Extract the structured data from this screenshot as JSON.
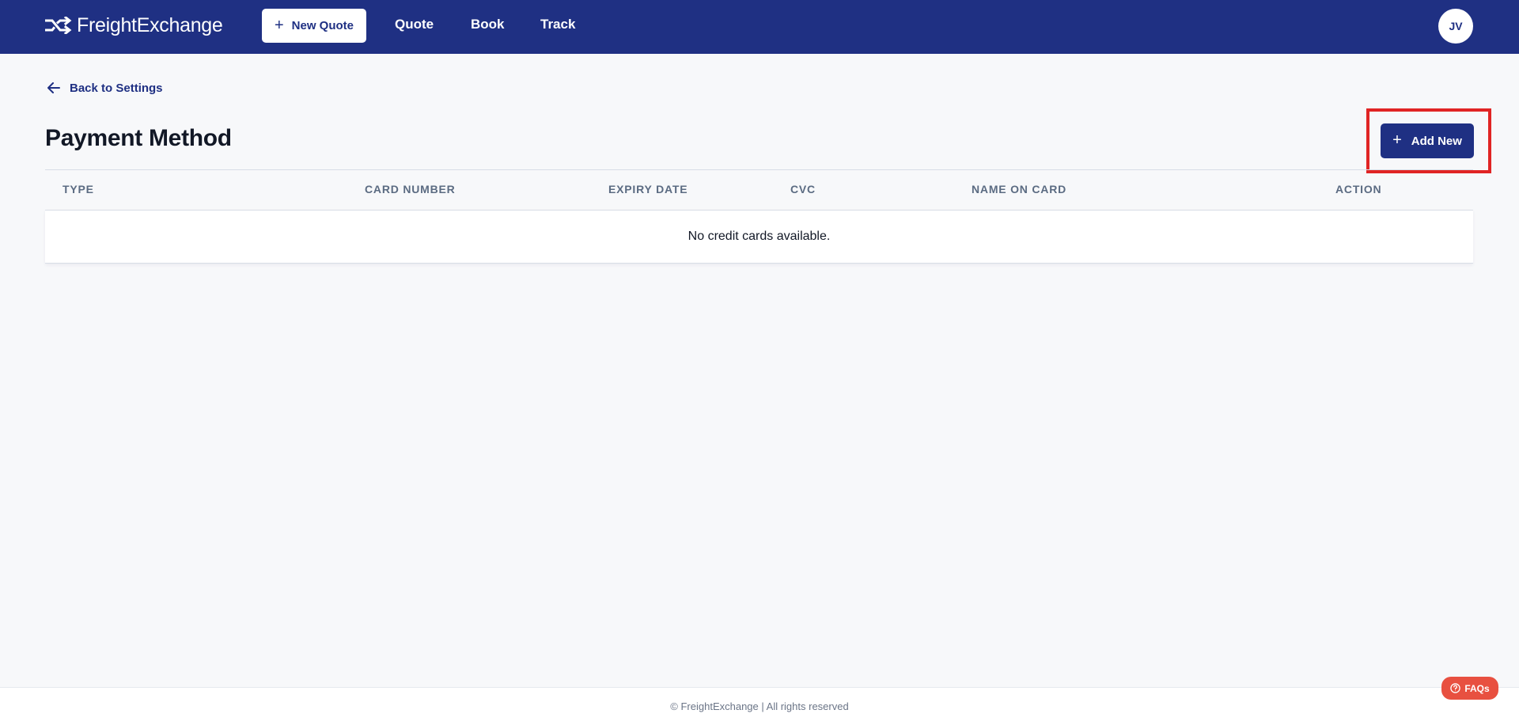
{
  "header": {
    "brand": "FreightExchange",
    "new_quote_label": "New Quote",
    "nav": [
      "Quote",
      "Book",
      "Track"
    ],
    "avatar_initials": "JV",
    "colors": {
      "bar": "#1f3083",
      "text": "#ffffff"
    }
  },
  "page": {
    "back_label": "Back to Settings",
    "title": "Payment Method",
    "add_new_label": "Add New"
  },
  "table": {
    "columns": [
      "TYPE",
      "CARD NUMBER",
      "EXPIRY DATE",
      "CVC",
      "NAME ON CARD",
      "ACTION"
    ],
    "rows": [],
    "empty_message": "No credit cards available."
  },
  "footer": {
    "copyright": "© FreightExchange | All rights reserved",
    "faq_label": "FAQs"
  },
  "icons": {
    "logo": "shuffle-arrows-icon",
    "new_quote": "plus-icon",
    "back": "arrow-left-icon",
    "add_new": "plus-icon",
    "faq": "help-circle-icon"
  },
  "colors": {
    "primary": "#1f3083",
    "highlight": "#e02424",
    "faq": "#e85040",
    "background": "#f7f8fa"
  }
}
